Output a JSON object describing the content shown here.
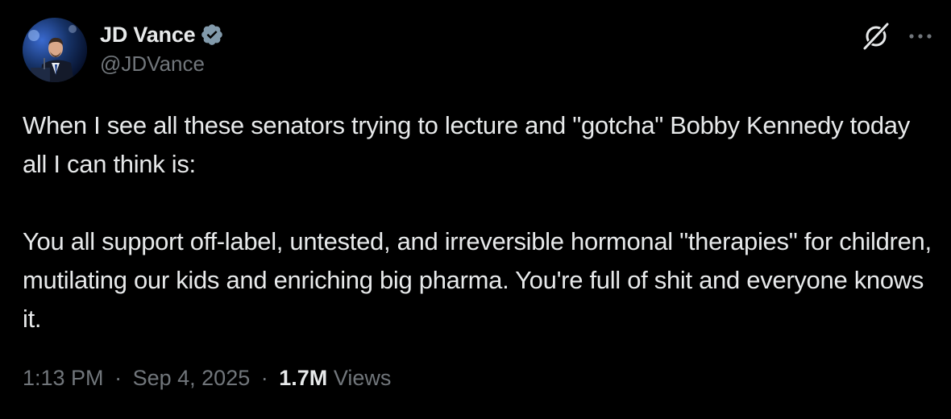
{
  "author": {
    "display_name": "JD Vance",
    "handle": "@JDVance",
    "verified": true,
    "verified_badge_icon": "verified-badge-icon"
  },
  "header_actions": {
    "grok_icon": "grok-icon",
    "more_icon": "more-options-icon"
  },
  "tweet": {
    "paragraphs": [
      "When I see all these senators trying to lecture and \"gotcha\" Bobby Kennedy today all I can think is:",
      "You all support off-label, untested, and irreversible hormonal \"therapies\" for children, mutilating our kids and enriching big pharma. You're full of shit and everyone knows it."
    ]
  },
  "meta": {
    "time": "1:13 PM",
    "separator": "·",
    "date": "Sep 4, 2025",
    "views_count": "1.7M",
    "views_label": "Views"
  },
  "colors": {
    "background": "#000000",
    "primary_text": "#e7e9ea",
    "secondary_text": "#71767b",
    "verified_badge": "#829aab"
  }
}
